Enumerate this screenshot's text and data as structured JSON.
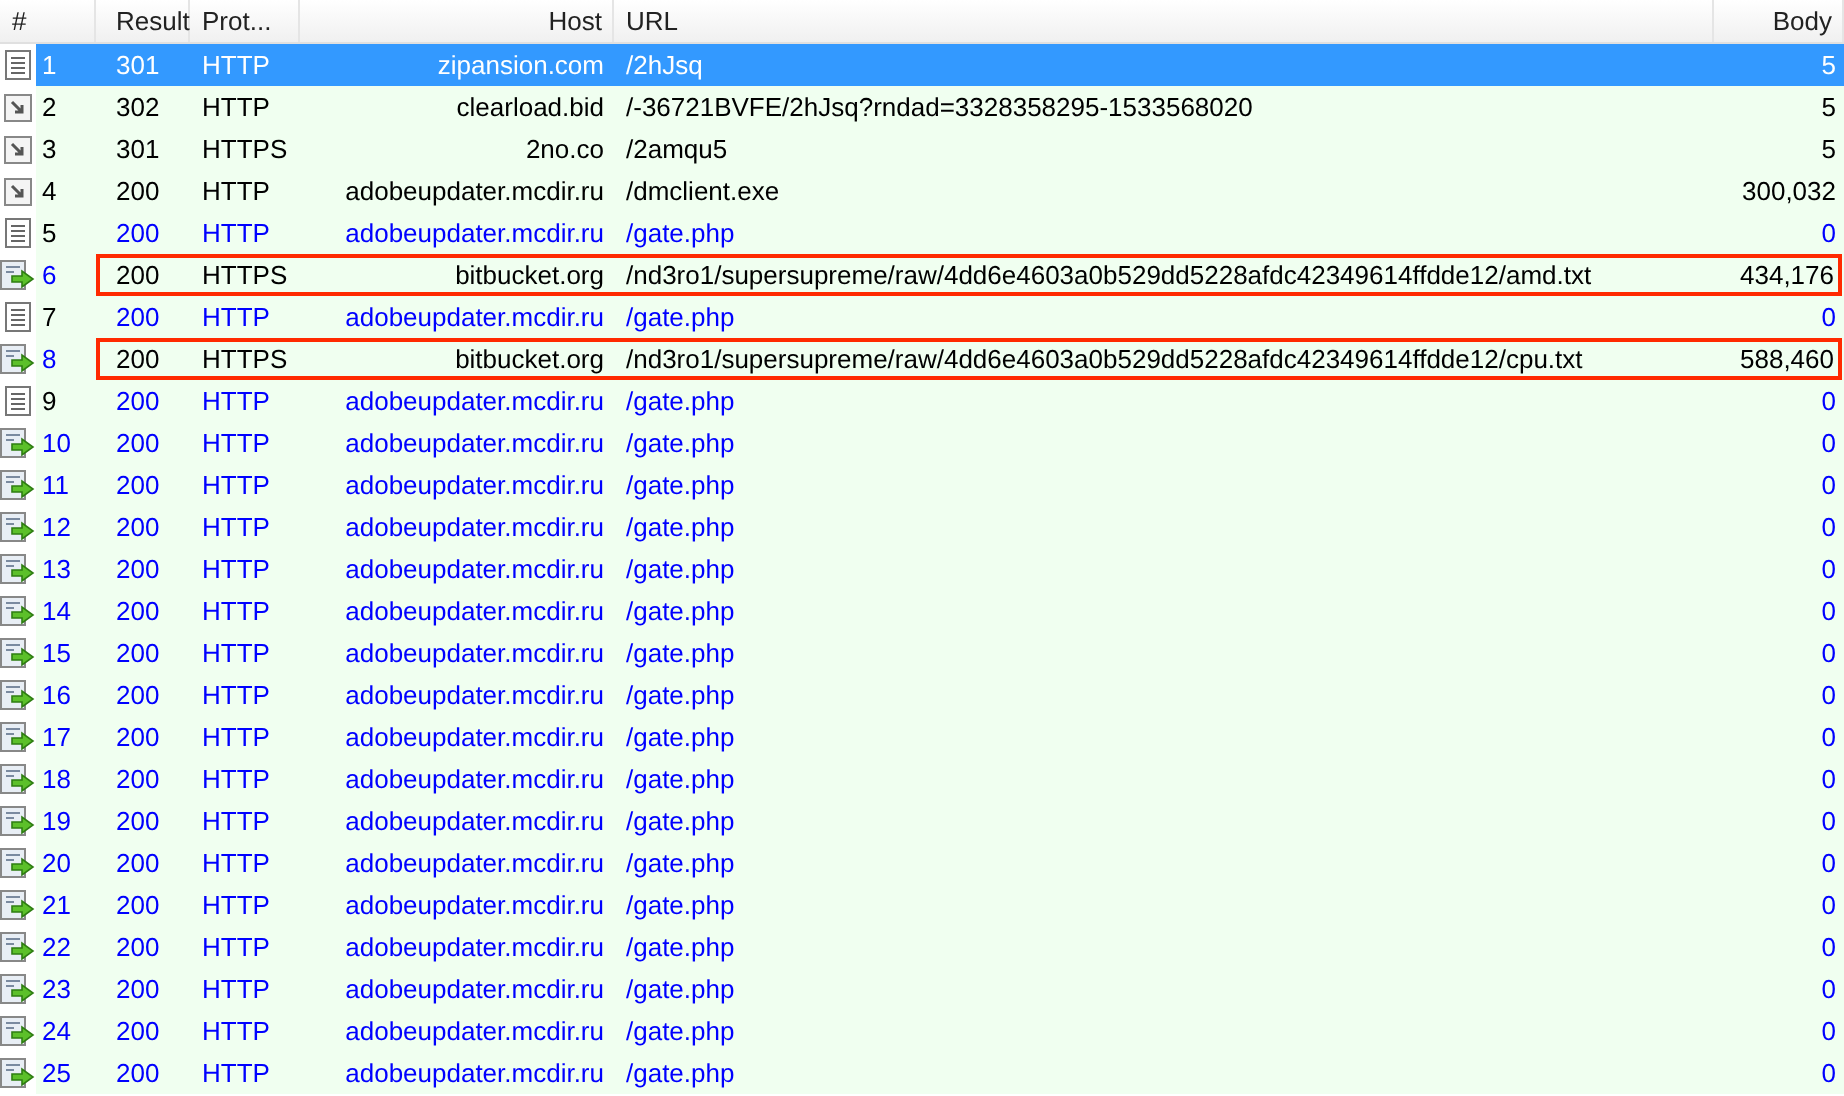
{
  "table": {
    "columns": [
      "#",
      "Result",
      "Prot...",
      "Host",
      "URL",
      "Body"
    ],
    "rows": [
      {
        "kind": "page",
        "number": "1",
        "result": "301",
        "protocol": "HTTP",
        "host": "zipansion.com",
        "url": "/2hJsq",
        "body": "5",
        "selected": true,
        "flagged": false
      },
      {
        "kind": "redirect",
        "number": "2",
        "result": "302",
        "protocol": "HTTP",
        "host": "clearload.bid",
        "url": "/-36721BVFE/2hJsq?rndad=3328358295-1533568020",
        "body": "5",
        "selected": false,
        "flagged": false,
        "text_highlighted": false,
        "number_highlighted": false
      },
      {
        "kind": "redirect",
        "number": "3",
        "result": "301",
        "protocol": "HTTPS",
        "host": "2no.co",
        "url": "/2amqu5",
        "body": "5",
        "selected": false,
        "flagged": false,
        "text_highlighted": false,
        "number_highlighted": false
      },
      {
        "kind": "redirect",
        "number": "4",
        "result": "200",
        "protocol": "HTTP",
        "host": "adobeupdater.mcdir.ru",
        "url": "/dmclient.exe",
        "body": "300,032",
        "selected": false,
        "flagged": false,
        "text_highlighted": false,
        "number_highlighted": false
      },
      {
        "kind": "page",
        "number": "5",
        "result": "200",
        "protocol": "HTTP",
        "host": "adobeupdater.mcdir.ru",
        "url": "/gate.php",
        "body": "0",
        "selected": false,
        "flagged": false,
        "text_highlighted": true,
        "number_highlighted": false
      },
      {
        "kind": "upload",
        "number": "6",
        "result": "200",
        "protocol": "HTTPS",
        "host": "bitbucket.org",
        "url": "/nd3ro1/supersupreme/raw/4dd6e4603a0b529dd5228afdc42349614ffdde12/amd.txt",
        "body": "434,176",
        "selected": false,
        "flagged": true,
        "text_highlighted": false,
        "number_highlighted": true
      },
      {
        "kind": "page",
        "number": "7",
        "result": "200",
        "protocol": "HTTP",
        "host": "adobeupdater.mcdir.ru",
        "url": "/gate.php",
        "body": "0",
        "selected": false,
        "flagged": false,
        "text_highlighted": true,
        "number_highlighted": false
      },
      {
        "kind": "upload",
        "number": "8",
        "result": "200",
        "protocol": "HTTPS",
        "host": "bitbucket.org",
        "url": "/nd3ro1/supersupreme/raw/4dd6e4603a0b529dd5228afdc42349614ffdde12/cpu.txt",
        "body": "588,460",
        "selected": false,
        "flagged": true,
        "text_highlighted": false,
        "number_highlighted": true
      },
      {
        "kind": "page",
        "number": "9",
        "result": "200",
        "protocol": "HTTP",
        "host": "adobeupdater.mcdir.ru",
        "url": "/gate.php",
        "body": "0",
        "selected": false,
        "flagged": false,
        "text_highlighted": true,
        "number_highlighted": false
      },
      {
        "kind": "upload",
        "number": "10",
        "result": "200",
        "protocol": "HTTP",
        "host": "adobeupdater.mcdir.ru",
        "url": "/gate.php",
        "body": "0",
        "selected": false,
        "flagged": false,
        "text_highlighted": true,
        "number_highlighted": true
      },
      {
        "kind": "upload",
        "number": "11",
        "result": "200",
        "protocol": "HTTP",
        "host": "adobeupdater.mcdir.ru",
        "url": "/gate.php",
        "body": "0",
        "selected": false,
        "flagged": false,
        "text_highlighted": true,
        "number_highlighted": true
      },
      {
        "kind": "upload",
        "number": "12",
        "result": "200",
        "protocol": "HTTP",
        "host": "adobeupdater.mcdir.ru",
        "url": "/gate.php",
        "body": "0",
        "selected": false,
        "flagged": false,
        "text_highlighted": true,
        "number_highlighted": true
      },
      {
        "kind": "upload",
        "number": "13",
        "result": "200",
        "protocol": "HTTP",
        "host": "adobeupdater.mcdir.ru",
        "url": "/gate.php",
        "body": "0",
        "selected": false,
        "flagged": false,
        "text_highlighted": true,
        "number_highlighted": true
      },
      {
        "kind": "upload",
        "number": "14",
        "result": "200",
        "protocol": "HTTP",
        "host": "adobeupdater.mcdir.ru",
        "url": "/gate.php",
        "body": "0",
        "selected": false,
        "flagged": false,
        "text_highlighted": true,
        "number_highlighted": true
      },
      {
        "kind": "upload",
        "number": "15",
        "result": "200",
        "protocol": "HTTP",
        "host": "adobeupdater.mcdir.ru",
        "url": "/gate.php",
        "body": "0",
        "selected": false,
        "flagged": false,
        "text_highlighted": true,
        "number_highlighted": true
      },
      {
        "kind": "upload",
        "number": "16",
        "result": "200",
        "protocol": "HTTP",
        "host": "adobeupdater.mcdir.ru",
        "url": "/gate.php",
        "body": "0",
        "selected": false,
        "flagged": false,
        "text_highlighted": true,
        "number_highlighted": true
      },
      {
        "kind": "upload",
        "number": "17",
        "result": "200",
        "protocol": "HTTP",
        "host": "adobeupdater.mcdir.ru",
        "url": "/gate.php",
        "body": "0",
        "selected": false,
        "flagged": false,
        "text_highlighted": true,
        "number_highlighted": true
      },
      {
        "kind": "upload",
        "number": "18",
        "result": "200",
        "protocol": "HTTP",
        "host": "adobeupdater.mcdir.ru",
        "url": "/gate.php",
        "body": "0",
        "selected": false,
        "flagged": false,
        "text_highlighted": true,
        "number_highlighted": true
      },
      {
        "kind": "upload",
        "number": "19",
        "result": "200",
        "protocol": "HTTP",
        "host": "adobeupdater.mcdir.ru",
        "url": "/gate.php",
        "body": "0",
        "selected": false,
        "flagged": false,
        "text_highlighted": true,
        "number_highlighted": true
      },
      {
        "kind": "upload",
        "number": "20",
        "result": "200",
        "protocol": "HTTP",
        "host": "adobeupdater.mcdir.ru",
        "url": "/gate.php",
        "body": "0",
        "selected": false,
        "flagged": false,
        "text_highlighted": true,
        "number_highlighted": true
      },
      {
        "kind": "upload",
        "number": "21",
        "result": "200",
        "protocol": "HTTP",
        "host": "adobeupdater.mcdir.ru",
        "url": "/gate.php",
        "body": "0",
        "selected": false,
        "flagged": false,
        "text_highlighted": true,
        "number_highlighted": true
      },
      {
        "kind": "upload",
        "number": "22",
        "result": "200",
        "protocol": "HTTP",
        "host": "adobeupdater.mcdir.ru",
        "url": "/gate.php",
        "body": "0",
        "selected": false,
        "flagged": false,
        "text_highlighted": true,
        "number_highlighted": true
      },
      {
        "kind": "upload",
        "number": "23",
        "result": "200",
        "protocol": "HTTP",
        "host": "adobeupdater.mcdir.ru",
        "url": "/gate.php",
        "body": "0",
        "selected": false,
        "flagged": false,
        "text_highlighted": true,
        "number_highlighted": true
      },
      {
        "kind": "upload",
        "number": "24",
        "result": "200",
        "protocol": "HTTP",
        "host": "adobeupdater.mcdir.ru",
        "url": "/gate.php",
        "body": "0",
        "selected": false,
        "flagged": false,
        "text_highlighted": true,
        "number_highlighted": true
      },
      {
        "kind": "upload",
        "number": "25",
        "result": "200",
        "protocol": "HTTP",
        "host": "adobeupdater.mcdir.ru",
        "url": "/gate.php",
        "body": "0",
        "selected": false,
        "flagged": false,
        "text_highlighted": true,
        "number_highlighted": true
      }
    ]
  }
}
